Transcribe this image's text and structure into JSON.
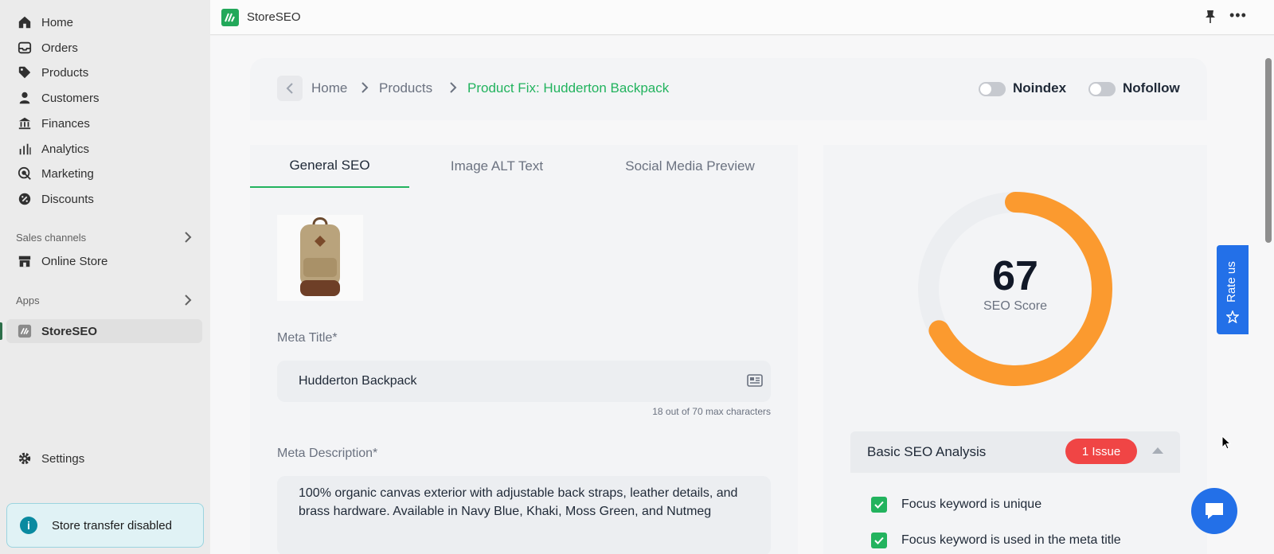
{
  "app": {
    "name": "StoreSEO"
  },
  "sidebar": {
    "items": [
      {
        "label": "Home",
        "icon": "home-icon"
      },
      {
        "label": "Orders",
        "icon": "inbox-icon"
      },
      {
        "label": "Products",
        "icon": "tag-icon"
      },
      {
        "label": "Customers",
        "icon": "person-icon"
      },
      {
        "label": "Finances",
        "icon": "bank-icon"
      },
      {
        "label": "Analytics",
        "icon": "bar-chart-icon"
      },
      {
        "label": "Marketing",
        "icon": "target-icon"
      },
      {
        "label": "Discounts",
        "icon": "discount-icon"
      }
    ],
    "sales_channels_label": "Sales channels",
    "online_store_label": "Online Store",
    "apps_label": "Apps",
    "app_item_label": "StoreSEO",
    "settings_label": "Settings",
    "banner_text": "Store transfer disabled"
  },
  "breadcrumb": {
    "home": "Home",
    "products": "Products",
    "current": "Product Fix: Hudderton Backpack"
  },
  "toggles": {
    "noindex": {
      "label": "Noindex",
      "on": false
    },
    "nofollow": {
      "label": "Nofollow",
      "on": false
    }
  },
  "tabs": [
    {
      "label": "General SEO",
      "active": true
    },
    {
      "label": "Image ALT Text",
      "active": false
    },
    {
      "label": "Social Media Preview",
      "active": false
    }
  ],
  "form": {
    "meta_title_label": "Meta Title*",
    "meta_title_value": "Hudderton Backpack",
    "meta_title_count": "18 out of 70 max characters",
    "meta_description_label": "Meta Description*",
    "meta_description_value": "100% organic canvas exterior with adjustable back straps, leather details, and brass hardware. Available in Navy Blue, Khaki, Moss Green, and Nutmeg"
  },
  "score": {
    "value": "67",
    "max": 100,
    "label": "SEO Score",
    "color": "#fb9a2f"
  },
  "analysis": {
    "title": "Basic SEO Analysis",
    "issue_badge": "1 Issue",
    "checks": [
      "Focus keyword is unique",
      "Focus keyword is used in the meta title"
    ]
  },
  "rate_us_label": "Rate us",
  "colors": {
    "accent": "#22b35e",
    "danger": "#f04545",
    "brand_blue": "#2370e8"
  }
}
